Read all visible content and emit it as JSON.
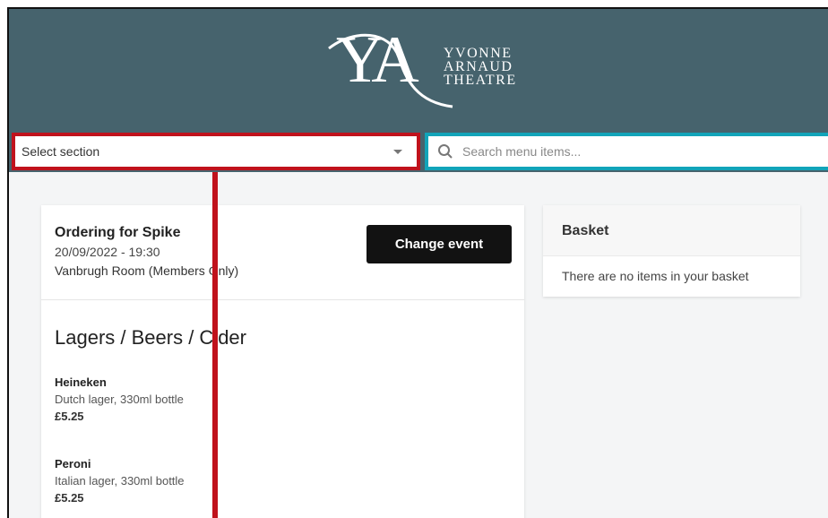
{
  "brand": {
    "letters": "YA",
    "words": [
      "YVONNE",
      "ARNAUD",
      "THEATRE"
    ]
  },
  "toolbar": {
    "section_select_value": "Select section",
    "search_placeholder": "Search menu items..."
  },
  "event": {
    "title": "Ordering for Spike",
    "datetime": "20/09/2022 - 19:30",
    "room": "Vanbrugh Room (Members Only)",
    "change_button": "Change event"
  },
  "menu": {
    "section_title": "Lagers / Beers / Cider",
    "items": [
      {
        "name": "Heineken",
        "desc": "Dutch lager, 330ml bottle",
        "price": "£5.25"
      },
      {
        "name": "Peroni",
        "desc": "Italian lager, 330ml bottle",
        "price": "£5.25"
      }
    ]
  },
  "basket": {
    "title": "Basket",
    "empty_text": "There are no items in your basket"
  },
  "colors": {
    "header": "#46636d",
    "select_highlight": "#c0121c",
    "search_highlight": "#12a4b9",
    "button": "#121212"
  }
}
